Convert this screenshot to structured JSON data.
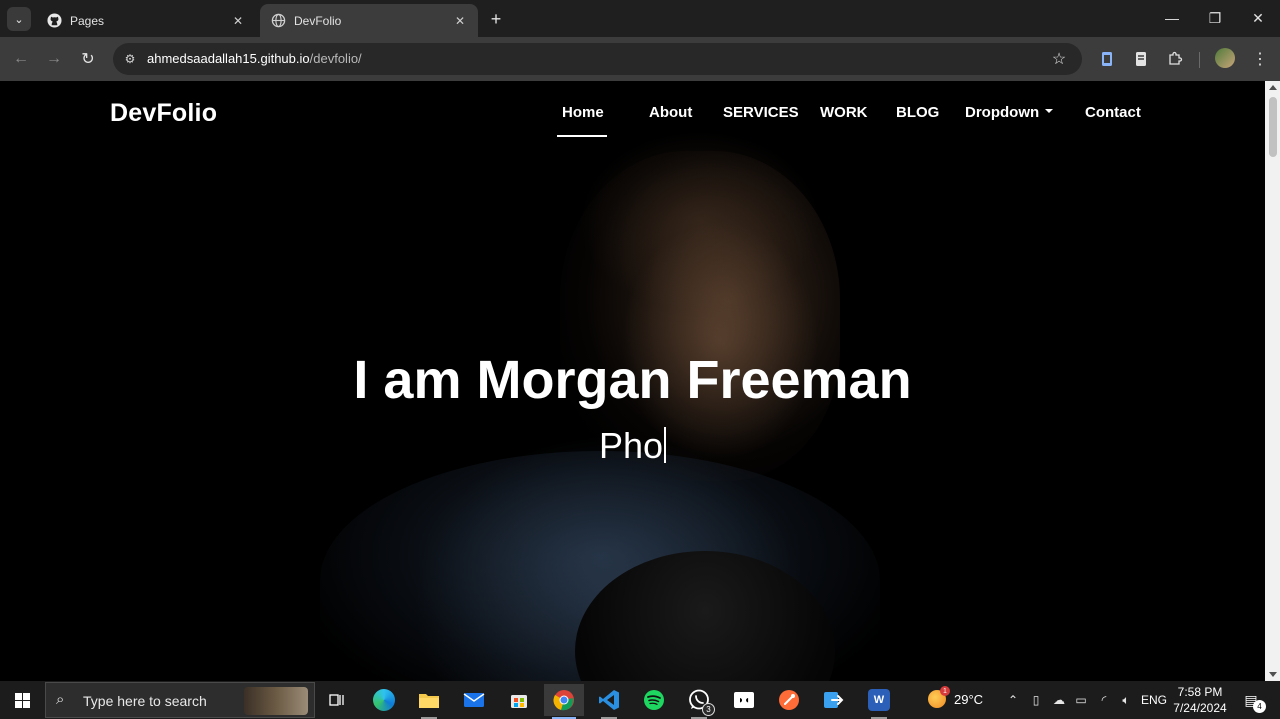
{
  "browser": {
    "tabs": [
      {
        "title": "Pages",
        "icon": "github-icon",
        "active": false
      },
      {
        "title": "DevFolio",
        "icon": "globe-icon",
        "active": true
      }
    ],
    "new_tab_label": "+",
    "url_host": "ahmedsaadallah15.github.io",
    "url_path": "/devfolio/"
  },
  "site": {
    "brand": "DevFolio",
    "nav": [
      {
        "label": "Home",
        "active": true
      },
      {
        "label": "About"
      },
      {
        "label": "SERVICES"
      },
      {
        "label": "WORK"
      },
      {
        "label": "BLOG"
      },
      {
        "label": "Dropdown",
        "has_caret": true
      },
      {
        "label": "Contact"
      }
    ],
    "hero_title": "I am Morgan Freeman",
    "hero_typed": "Pho"
  },
  "taskbar": {
    "search_placeholder": "Type here to search",
    "apps": [
      {
        "name": "task-view",
        "icon": "task-view-icon"
      },
      {
        "name": "edge",
        "icon": "edge-icon"
      },
      {
        "name": "file-explorer",
        "icon": "folder-icon"
      },
      {
        "name": "mail",
        "icon": "mail-icon"
      },
      {
        "name": "store",
        "icon": "store-icon"
      },
      {
        "name": "chrome",
        "icon": "chrome-icon",
        "active": true
      },
      {
        "name": "vscode",
        "icon": "vscode-icon",
        "running": true
      },
      {
        "name": "spotify",
        "icon": "spotify-icon"
      },
      {
        "name": "whatsapp",
        "icon": "whatsapp-icon",
        "badge": "3",
        "running": true
      },
      {
        "name": "dolby",
        "icon": "dolby-icon"
      },
      {
        "name": "postman",
        "icon": "postman-icon"
      },
      {
        "name": "quick-share",
        "icon": "share-icon"
      },
      {
        "name": "word",
        "icon": "word-icon",
        "running": true
      }
    ],
    "weather_temp": "29°C",
    "weather_badge": "1",
    "language": "ENG",
    "time": "7:58 PM",
    "date": "7/24/2024",
    "notification_count": "4"
  },
  "colors": {
    "tabstrip_bg": "#1f1f1f",
    "toolbar_bg": "#3c3c3c",
    "page_bg": "#000000",
    "taskbar_bg": "#1c1c1c"
  }
}
